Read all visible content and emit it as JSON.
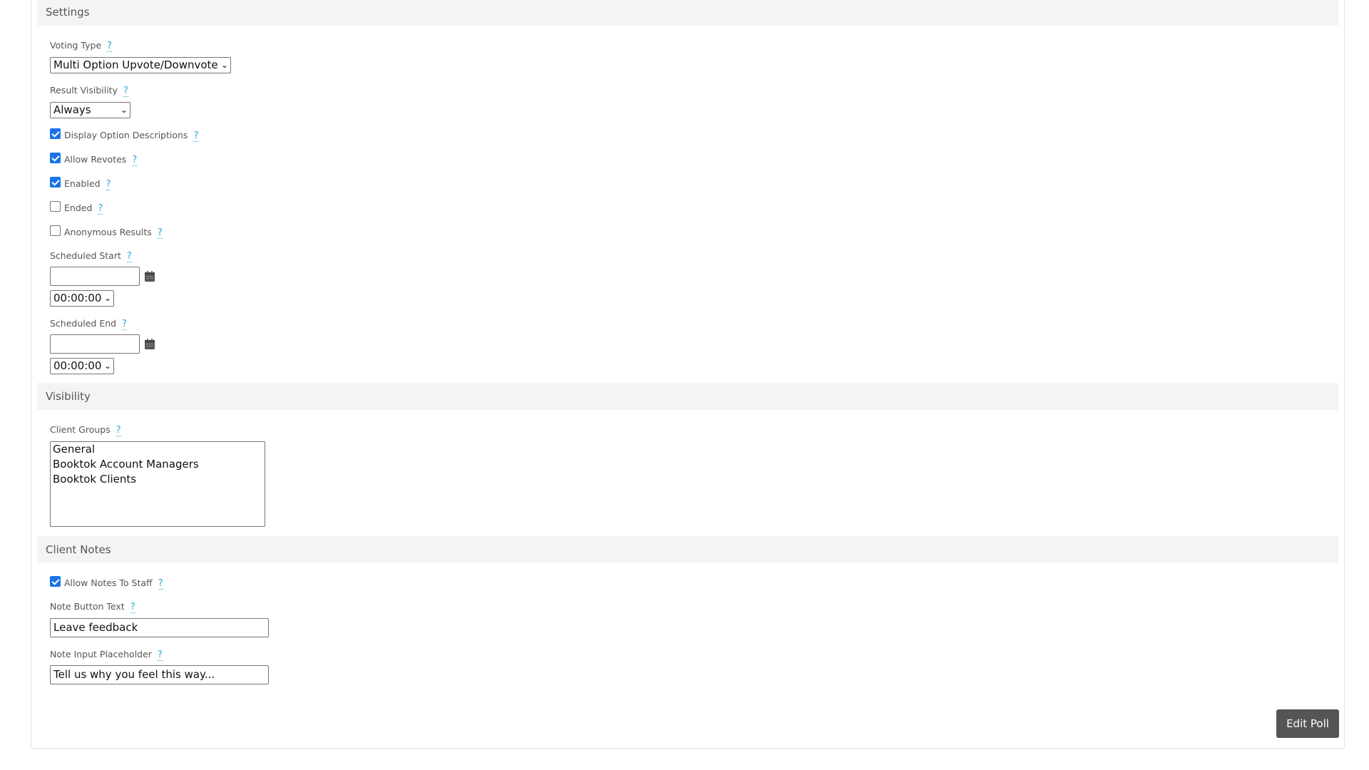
{
  "settings": {
    "header": "Settings",
    "voting_type": {
      "label": "Voting Type",
      "value": "Multi Option Upvote/Downvote"
    },
    "result_visibility": {
      "label": "Result Visibility",
      "value": "Always"
    },
    "checkboxes": [
      {
        "label": "Display Option Descriptions",
        "checked": true
      },
      {
        "label": "Allow Revotes",
        "checked": true
      },
      {
        "label": "Enabled",
        "checked": true
      },
      {
        "label": "Ended",
        "checked": false
      },
      {
        "label": "Anonymous Results",
        "checked": false
      }
    ],
    "scheduled_start": {
      "label": "Scheduled Start",
      "date": "",
      "time": "00:00:00"
    },
    "scheduled_end": {
      "label": "Scheduled End",
      "date": "",
      "time": "00:00:00"
    }
  },
  "visibility": {
    "header": "Visibility",
    "client_groups": {
      "label": "Client Groups",
      "options": [
        "General",
        "Booktok Account Managers",
        "Booktok Clients"
      ]
    }
  },
  "client_notes": {
    "header": "Client Notes",
    "allow_notes": {
      "label": "Allow Notes To Staff",
      "checked": true
    },
    "note_button_text": {
      "label": "Note Button Text",
      "value": "Leave feedback"
    },
    "note_input_placeholder": {
      "label": "Note Input Placeholder",
      "value": "Tell us why you feel this way..."
    }
  },
  "help_glyph": "?",
  "chevron_glyph": "⌄",
  "actions": {
    "edit_poll": "Edit Poll"
  }
}
